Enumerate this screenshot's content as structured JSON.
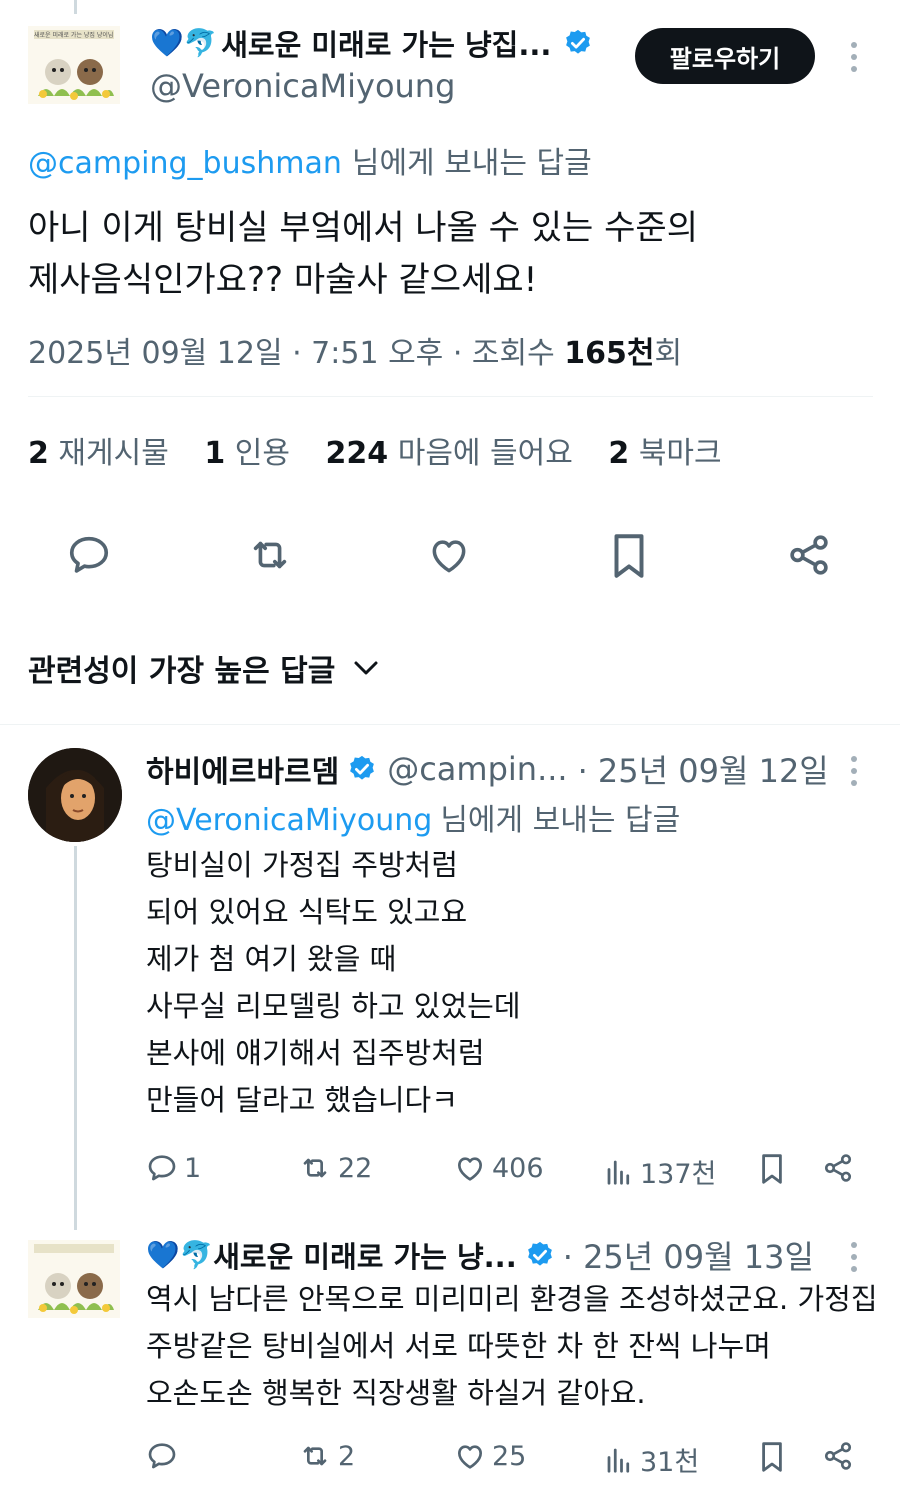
{
  "tweet": {
    "author": {
      "emoji_prefix": "💙🐬",
      "display_name": "새로운 미래로 가는 냥집...",
      "handle": "@VeronicaMiyoung",
      "avatar_caption": "새로운 미래로 가는 냥집 냥이님"
    },
    "follow_label": "팔로우하기",
    "reply_to_handle": "@camping_bushman",
    "reply_to_suffix": "님에게 보내는 답글",
    "text_line1": "아니 이게 탕비실 부엌에서 나올 수 있는 수준의",
    "text_line2": "제사음식인가요?? 마술사 같으세요!",
    "meta_prefix": "2025년 09월 12일 · 7:51 오후 · 조회수 ",
    "views_value": "165천",
    "views_suffix": "회",
    "stats": {
      "reposts_count": "2",
      "reposts_label": "재게시물",
      "quotes_count": "1",
      "quotes_label": "인용",
      "likes_count": "224",
      "likes_label": "마음에 들어요",
      "bookmarks_count": "2",
      "bookmarks_label": "북마크"
    }
  },
  "sort": {
    "label": "관련성이 가장 높은 답글"
  },
  "replies": [
    {
      "display_name": "하비에르바르뎀",
      "handle": "@campin...",
      "date": "· 25년 09월 12일",
      "reply_to_handle": "@VeronicaMiyoung",
      "reply_to_suffix": "님에게 보내는 답글",
      "lines": [
        "탕비실이 가정집 주방처럼",
        "되어 있어요 식탁도 있고요",
        "제가 첨 여기 왔을 때",
        "사무실 리모델링 하고 있었는데",
        "본사에 얘기해서 집주방처럼",
        "만들어 달라고 했습니다ㅋ"
      ],
      "replies_count": "1",
      "reposts_count": "22",
      "likes_count": "406",
      "views_count": "137천"
    },
    {
      "emoji_prefix": "💙🐬",
      "display_name": "새로운 미래로 가는 냥...",
      "date": "· 25년 09월 13일",
      "lines": [
        "역시 남다른 안목으로 미리미리 환경을 조성하셨군요. 가정집",
        "주방같은 탕비실에서 서로 따뜻한 차 한 잔씩 나누며",
        "오손도손 행복한 직장생활 하실거 같아요."
      ],
      "replies_count": "",
      "reposts_count": "2",
      "likes_count": "25",
      "views_count": "31천"
    }
  ],
  "colors": {
    "accent": "#1d9bf0",
    "text": "#0f1419",
    "muted": "#536471",
    "divider": "#eff3f4",
    "button_bg": "#0f1419"
  },
  "icons": [
    "reply-icon",
    "repost-icon",
    "like-icon",
    "bookmark-icon",
    "share-icon",
    "views-icon",
    "verified-badge-icon",
    "more-icon",
    "chevron-down-icon"
  ]
}
